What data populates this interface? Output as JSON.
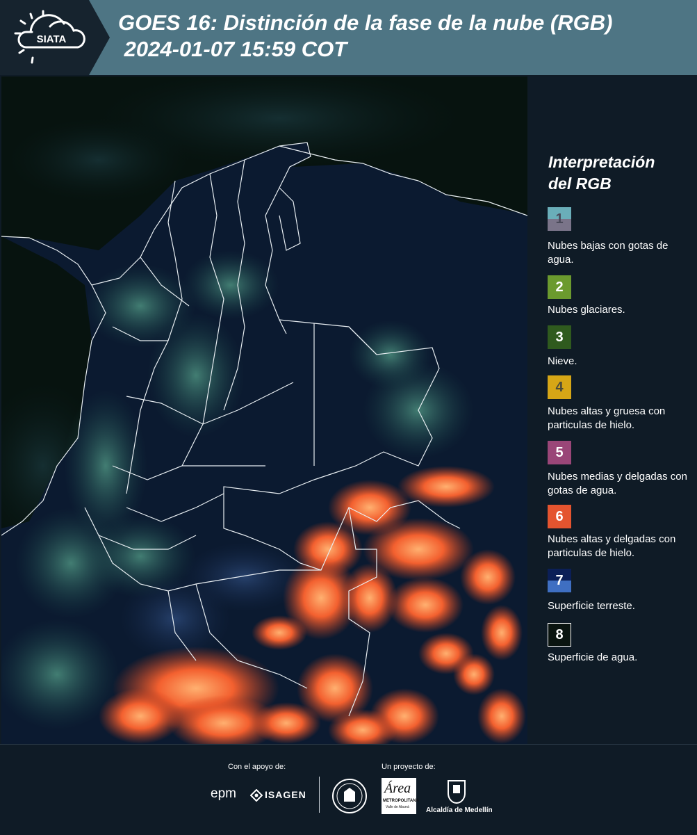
{
  "header": {
    "logo_text": "SIATA",
    "title": "GOES 16: Distinción de la fase de la nube (RGB)\n 2024-01-07 15:59 COT"
  },
  "legend": {
    "title_line1": "Interpretación",
    "title_line2": "del RGB",
    "items": [
      {
        "num": "1",
        "label": "Nubes bajas con gotas de agua.",
        "color": "#6aaeb9",
        "color2": "#7a7489"
      },
      {
        "num": "2",
        "label": "Nubes glaciares.",
        "color": "#6b9a2e"
      },
      {
        "num": "3",
        "label": "Nieve.",
        "color": "#2f5a1e"
      },
      {
        "num": "4",
        "label": "Nubes altas y gruesa con particulas de hielo.",
        "color": "#d6a616"
      },
      {
        "num": "5",
        "label": "Nubes medias y delgadas con gotas de agua.",
        "color": "#9a4678"
      },
      {
        "num": "6",
        "label": "Nubes altas y delgadas con particulas de hielo.",
        "color": "#e4542f"
      },
      {
        "num": "7",
        "label": "Superficie terreste.",
        "color": "#0b1f57",
        "color2": "#3f6fc2"
      },
      {
        "num": "8",
        "label": "Superficie de agua.",
        "color": "#0a1410"
      }
    ]
  },
  "footer": {
    "support_label": "Con el apoyo de:",
    "project_label": "Un proyecto de:",
    "epm": "epm",
    "isagen": "ISAGEN",
    "metro_word": "Área",
    "metro_sub": "METROPOLITANA",
    "metro_sub2": "Valle de Aburrá",
    "alcaldia": "Alcaldía de Medellín"
  }
}
